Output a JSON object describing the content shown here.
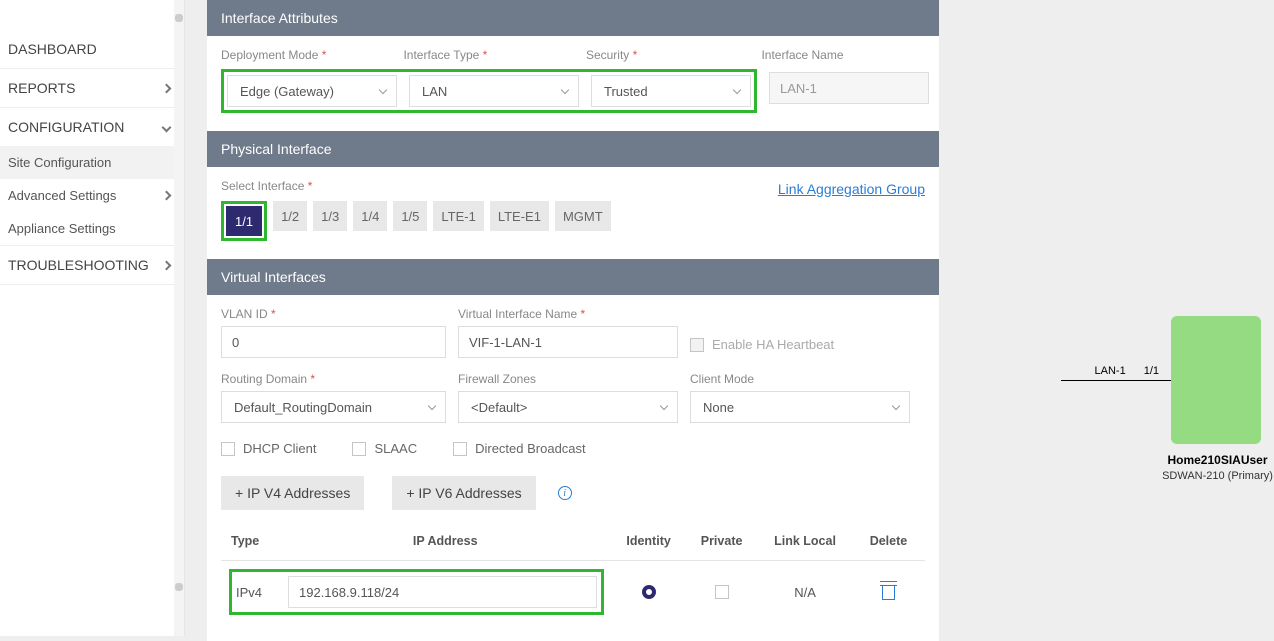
{
  "sidebar": {
    "dashboard": "DASHBOARD",
    "reports": "REPORTS",
    "configuration": "CONFIGURATION",
    "site_conf": "Site Configuration",
    "adv": "Advanced Settings",
    "app": "Appliance Settings",
    "troubleshoot": "TROUBLESHOOTING"
  },
  "attrs": {
    "title": "Interface Attributes",
    "dep_lbl": "Deployment Mode",
    "dep_val": "Edge (Gateway)",
    "if_lbl": "Interface Type",
    "if_val": "LAN",
    "sec_lbl": "Security",
    "sec_val": "Trusted",
    "name_lbl": "Interface Name",
    "name_val": "LAN-1"
  },
  "phys": {
    "title": "Physical Interface",
    "sel_lbl": "Select Interface",
    "link": "Link Aggregation Group",
    "pills": [
      "1/1",
      "1/2",
      "1/3",
      "1/4",
      "1/5",
      "LTE-1",
      "LTE-E1",
      "MGMT"
    ]
  },
  "virt": {
    "title": "Virtual Interfaces",
    "vlan_lbl": "VLAN ID",
    "vlan_val": "0",
    "vifname_lbl": "Virtual Interface Name",
    "vifname_val": "VIF-1-LAN-1",
    "ha": "Enable HA Heartbeat",
    "rd_lbl": "Routing Domain",
    "rd_val": "Default_RoutingDomain",
    "fw_lbl": "Firewall Zones",
    "fw_val": "<Default>",
    "cm_lbl": "Client Mode",
    "cm_val": "None",
    "dhcp": "DHCP Client",
    "slaac": "SLAAC",
    "db": "Directed Broadcast",
    "ipv4btn": "+ IP V4 Addresses",
    "ipv6btn": "+ IP V6 Addresses",
    "col_type": "Type",
    "col_ip": "IP Address",
    "col_ident": "Identity",
    "col_priv": "Private",
    "col_ll": "Link Local",
    "col_del": "Delete",
    "row_type": "IPv4",
    "row_ip": "192.168.9.118/24",
    "row_ll": "N/A"
  },
  "topo": {
    "wl_left": "LAN-1",
    "wl_right": "1/1",
    "dev_name": "Home210SIAUser",
    "dev_model": "SDWAN-210 (Primary)"
  }
}
